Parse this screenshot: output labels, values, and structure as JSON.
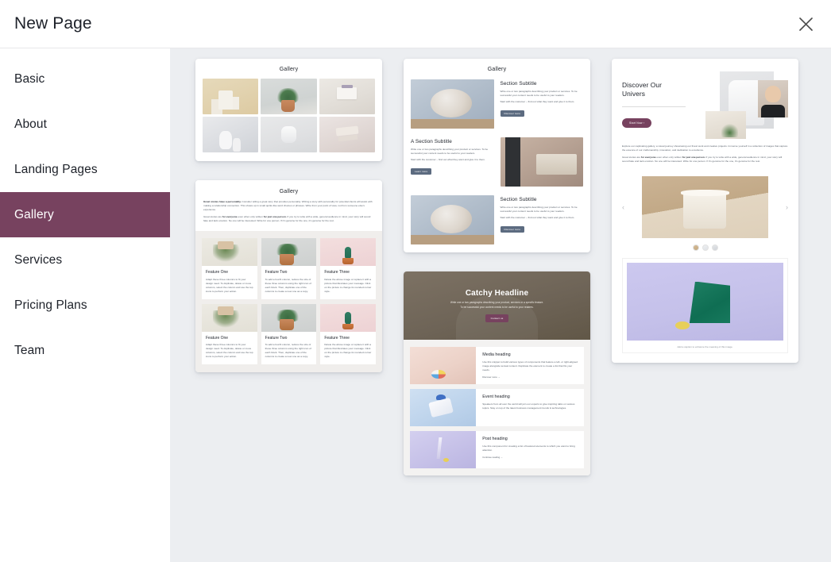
{
  "header": {
    "title": "New Page",
    "close_icon": "close-icon"
  },
  "sidebar": {
    "items": [
      {
        "label": "Basic",
        "active": false
      },
      {
        "label": "About",
        "active": false
      },
      {
        "label": "Landing Pages",
        "active": false
      },
      {
        "label": "Gallery",
        "active": true
      },
      {
        "label": "Services",
        "active": false
      },
      {
        "label": "Pricing Plans",
        "active": false
      },
      {
        "label": "Team",
        "active": false
      }
    ],
    "active_color": "#77425f"
  },
  "templates": {
    "gallery_grid": {
      "title": "Gallery"
    },
    "gallery_text": {
      "title": "Gallery",
      "paragraph_1_lead": "Great stories have a",
      "paragraph_1_bold": "personality.",
      "paragraph_1_rest": "Consider telling a great story that provides personality. Writing a story with personality for potential clients will assist with making a relationship connection. This shows up in small quirks like word choices or phrases. Write from your point of view, not from someone else's experience.",
      "paragraph_2_lead": "Great stories are",
      "paragraph_2_bold": "for everyone",
      "paragraph_2_mid": "even when only written",
      "paragraph_2_bold2": "for just one person.",
      "paragraph_2_rest": "If you try to write with a wide, general audience in mind, your story will sound fake and lack emotion. No one will be interested. Write for one person. If it's genuine for the one, it's genuine for the rest.",
      "features": [
        {
          "heading": "Feature One",
          "body": "Adapt these three columns to fit your design need. To duplicate, delete or move columns, select the column and use the top icons to perform your action."
        },
        {
          "heading": "Feature Two",
          "body": "To add a fourth column, reduce the size of these three columns using the right icon of each block. Then, duplicate one of the columns to create a new one as a copy."
        },
        {
          "heading": "Feature Three",
          "body": "Delete the above image or replace it with a picture that illustrates your message. Click on the picture to change its rounded corner style."
        }
      ]
    },
    "gallery_sections": {
      "title": "Gallery",
      "sections": [
        {
          "heading": "Section Subtitle",
          "body_1": "Write one or two paragraphs describing your product or services. To be successful your content needs to be useful to your readers.",
          "body_2": "Start with the customer – find out what they want and give it to them.",
          "button": "Discover more"
        },
        {
          "heading": "A Section Subtitle",
          "body_1": "Write one or two paragraphs describing your product or services. To be successful your content needs to be useful to your readers.",
          "body_2": "Start with the customer – find out what they want and give it to them.",
          "button": "Learn more"
        },
        {
          "heading": "Section Subtitle",
          "body_1": "Write one or two paragraphs describing your product or services. To be successful your content needs to be useful to your readers.",
          "body_2": "Start with the customer – find out what they want and give it to them.",
          "button": "Discover more"
        }
      ]
    },
    "catchy_headline": {
      "heading": "Catchy Headline",
      "body_line_1": "Write one or two paragraphs describing your product, services or a specific feature.",
      "body_line_2": "To be successful your content needs to be useful to your readers.",
      "button": "Contact us",
      "button_color": "#77425f",
      "rows": [
        {
          "heading": "Media heading",
          "body": "Use this snippet to build various types of components that feature a left- or right-aligned image alongside textual content. Duplicate the element to create a list that fits your needs.",
          "link": "Discover more →"
        },
        {
          "heading": "Event heading",
          "body": "Speakers from all over the world will join our experts to give inspiring talks on various topics. Stay on top of the latest business management trends & technologies.",
          "link": ""
        },
        {
          "heading": "Post heading",
          "body": "Use this component for creating a list of featured elements to which you want to bring attention.",
          "link": "Continue reading →"
        }
      ]
    },
    "discover": {
      "heading_line_1": "Discover Our",
      "heading_line_2": "Univers",
      "button": "Start Now ›",
      "button_color": "#77425f",
      "paragraph_1": "Explore our captivating gallery, a visual journey showcasing our finest work and creative projects. Immerse yourself in a collection of images that capture the essence of our craftsmanship, innovation, and dedication to excellence.",
      "paragraph_2_lead": "Great stories are",
      "paragraph_2_bold": "for everyone",
      "paragraph_2_mid": "even when only written",
      "paragraph_2_bold2": "for just one person.",
      "paragraph_2_rest": "If you try to write with a wide, general audience in mind, your story will sound fake and lack emotion. No one will be interested. Write for one person. If it's genuine for the one, it's genuine for the rest.",
      "carousel": {
        "prev_icon": "chevron-left-icon",
        "next_icon": "chevron-right-icon",
        "dot_count": 3,
        "active_dot": 1
      },
      "figure_caption": "Add a caption to enhance the meaning of this image."
    }
  }
}
